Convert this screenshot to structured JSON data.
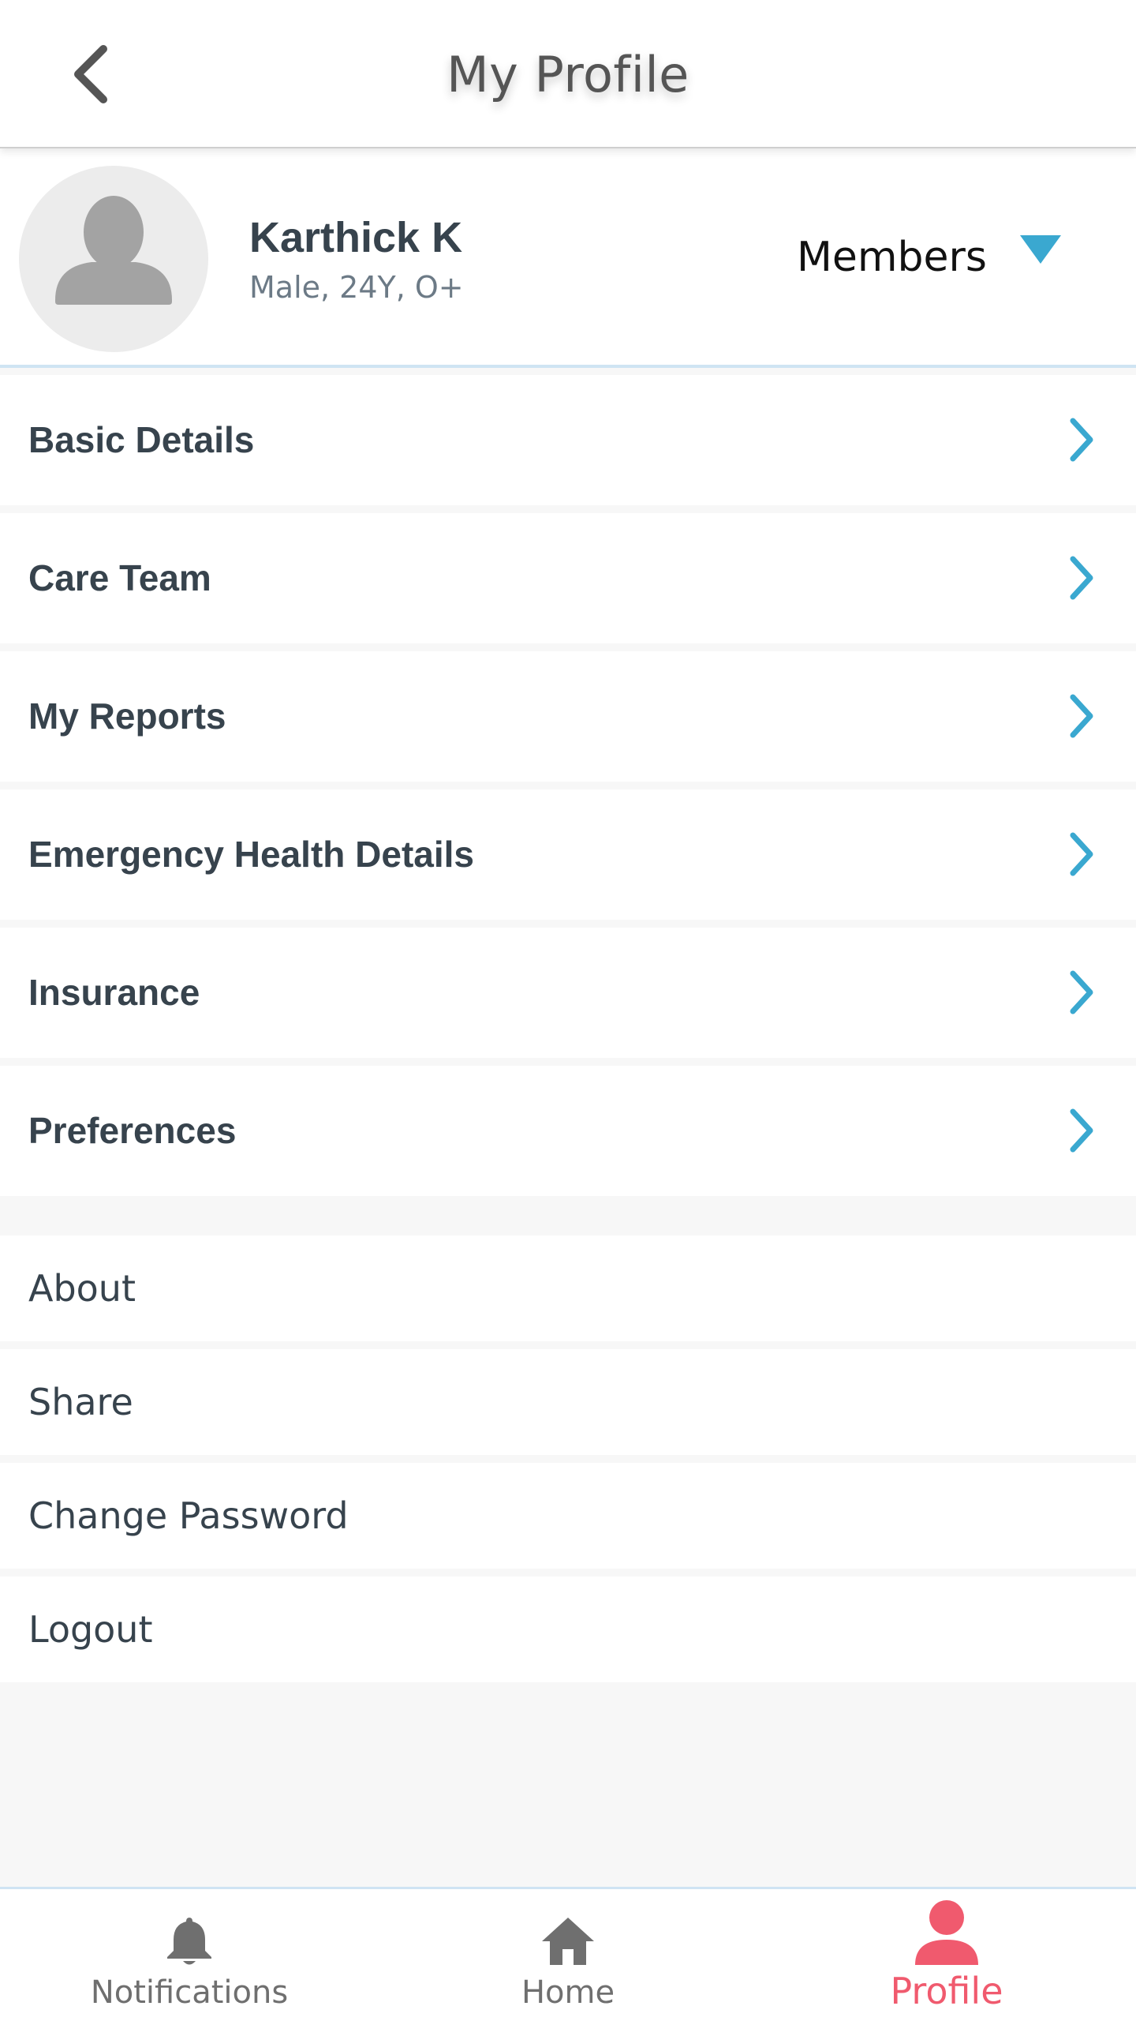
{
  "header": {
    "title": "My Profile",
    "back_icon": "chevron-left-icon"
  },
  "profile": {
    "name": "Karthick K",
    "meta": "Male, 24Y, O+",
    "members_label": "Members",
    "avatar_icon": "person-placeholder-icon"
  },
  "menu": {
    "items": [
      {
        "label": "Basic Details"
      },
      {
        "label": "Care Team"
      },
      {
        "label": "My Reports"
      },
      {
        "label": "Emergency Health Details"
      },
      {
        "label": "Insurance"
      },
      {
        "label": "Preferences"
      }
    ],
    "secondary": [
      {
        "label": "About"
      },
      {
        "label": "Share"
      },
      {
        "label": "Change Password"
      },
      {
        "label": "Logout"
      }
    ]
  },
  "bottom_nav": {
    "items": [
      {
        "label": "Notifications",
        "icon": "bell-icon",
        "active": false
      },
      {
        "label": "Home",
        "icon": "home-icon",
        "active": false
      },
      {
        "label": "Profile",
        "icon": "person-icon",
        "active": true
      }
    ]
  },
  "colors": {
    "accent_blue": "#3aa8d0",
    "active_pink": "#f05a6e",
    "text_dark": "#37434d",
    "background": "#f7f7f7"
  }
}
